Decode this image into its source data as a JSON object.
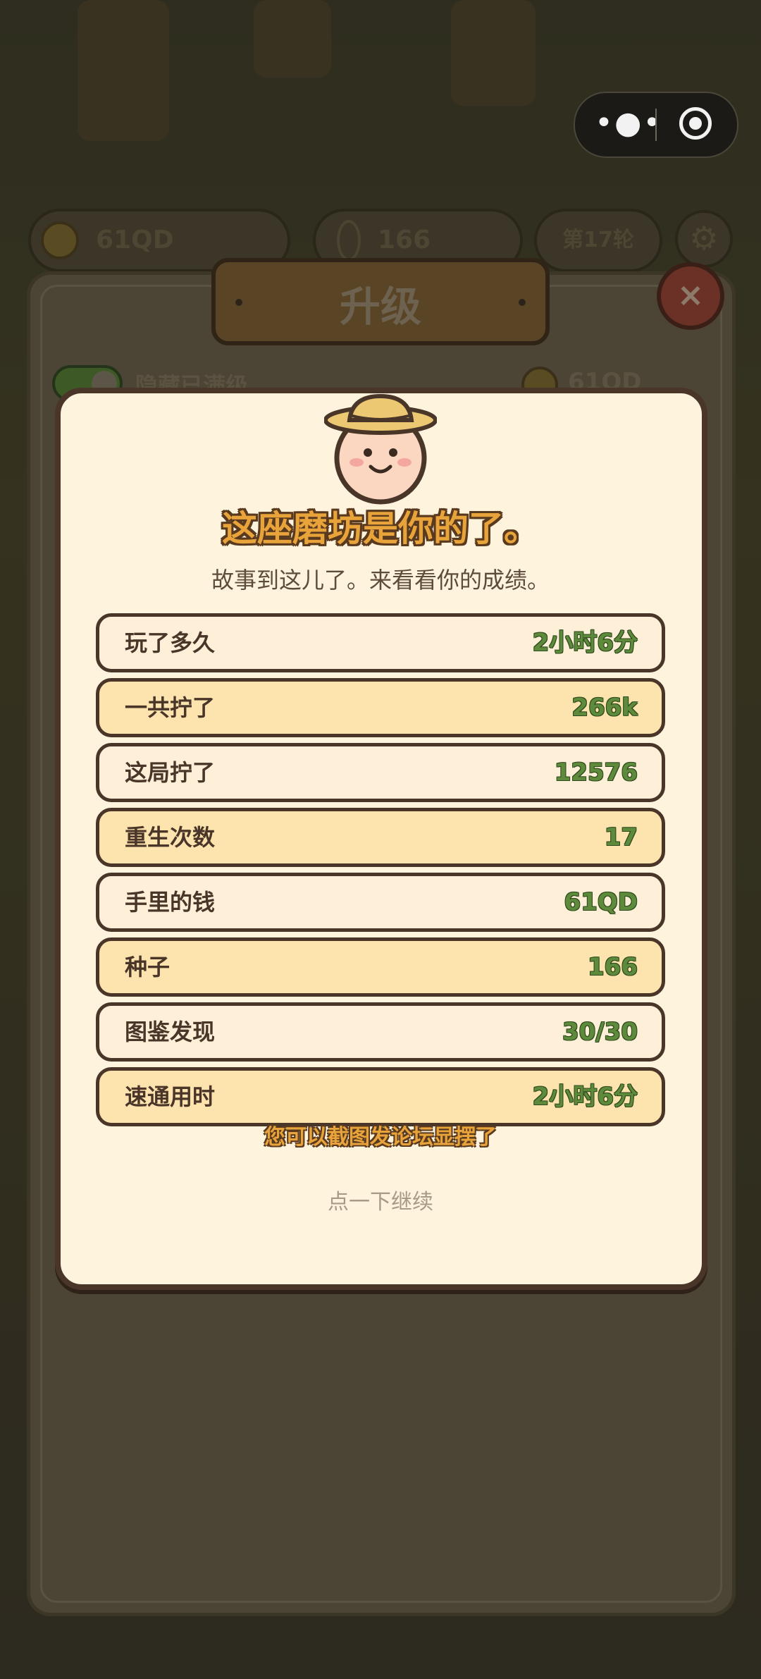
{
  "capsule": {
    "more_icon": "more-dots-icon",
    "close_icon": "target-icon"
  },
  "hud": {
    "coins": "61QD",
    "seeds": "166",
    "round": "第17轮",
    "settings_icon": "gear-icon"
  },
  "panel": {
    "title": "升级",
    "toggle_label": "隐藏已满级",
    "coins": "61QD",
    "close_label": "×"
  },
  "modal": {
    "title": "这座磨坊是你的了。",
    "subtitle": "故事到这儿了。来看看你的成绩。",
    "stats": [
      {
        "label": "玩了多久",
        "value": "2小时6分"
      },
      {
        "label": "一共拧了",
        "value": "266k"
      },
      {
        "label": "这局拧了",
        "value": "12576"
      },
      {
        "label": "重生次数",
        "value": "17"
      },
      {
        "label": "手里的钱",
        "value": "61QD"
      },
      {
        "label": "种子",
        "value": "166"
      },
      {
        "label": "图鉴发现",
        "value": "30/30"
      },
      {
        "label": "速通用时",
        "value": "2小时6分"
      }
    ],
    "hint": "您可以截图发论坛显摆了",
    "continue": "点一下继续"
  },
  "colors": {
    "title_gold": "#e8a33a",
    "value_green": "#5e8a3c",
    "border_brown": "#4a3629",
    "row_gold": "#fde3ad",
    "modal_bg": "#fef3dd"
  }
}
